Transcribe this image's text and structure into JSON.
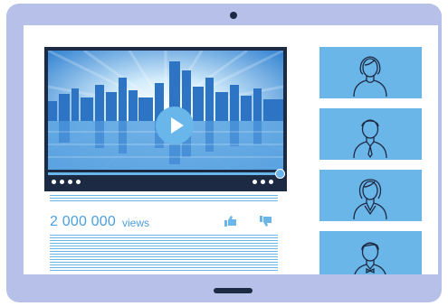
{
  "video": {
    "views_count": "2 000 000",
    "views_label": "views",
    "progress": 0.99
  },
  "icons": {
    "play": "play-icon",
    "like": "thumbs-up-icon",
    "dislike": "thumbs-down-icon",
    "camera": "camera-icon"
  },
  "participants": [
    {
      "avatar": "woman-avatar-icon"
    },
    {
      "avatar": "man-tie-avatar-icon"
    },
    {
      "avatar": "woman-suit-avatar-icon"
    },
    {
      "avatar": "man-bowtie-avatar-icon"
    }
  ],
  "colors": {
    "frame": "#b6c0e8",
    "accent": "#6bb6e8",
    "dark": "#1d2a44",
    "text": "#4a9fe0"
  }
}
